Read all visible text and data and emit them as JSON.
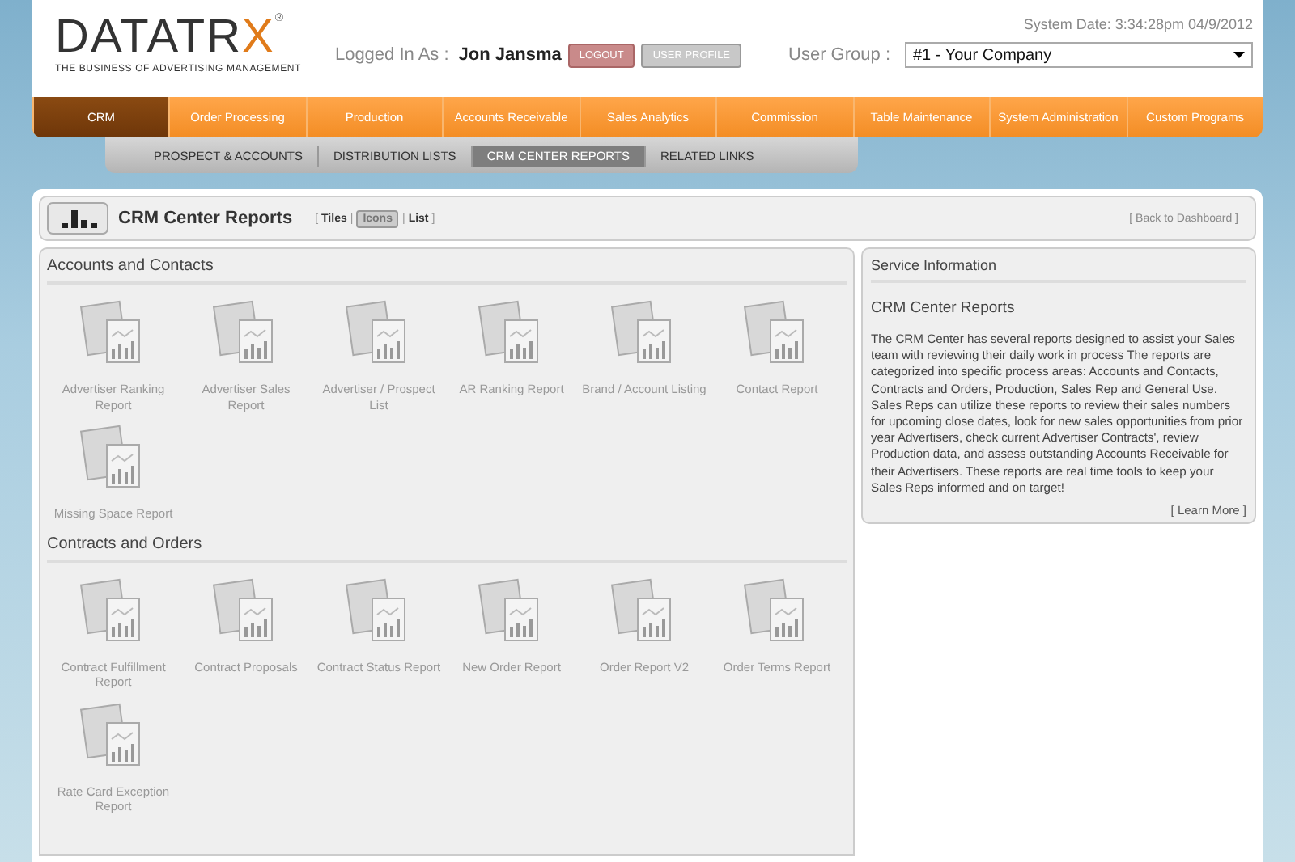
{
  "header": {
    "logo": {
      "wordmark": "DATATR",
      "accent": "X",
      "registered": "®",
      "tagline": "THE BUSINESS OF ADVERTISING MANAGEMENT"
    },
    "system_date": "System Date: 3:34:28pm 04/9/2012",
    "logged_in_label": "Logged In As :",
    "user_name": "Jon Jansma",
    "logout_button": "LOGOUT",
    "profile_button": "USER PROFILE",
    "user_group_label": "User Group :",
    "user_group_value": "#1 - Your Company"
  },
  "main_nav": [
    {
      "label": "CRM",
      "selected": true
    },
    {
      "label": "Order Processing",
      "selected": false
    },
    {
      "label": "Production",
      "selected": false
    },
    {
      "label": "Accounts Receivable",
      "selected": false
    },
    {
      "label": "Sales Analytics",
      "selected": false
    },
    {
      "label": "Commission",
      "selected": false
    },
    {
      "label": "Table Maintenance",
      "selected": false
    },
    {
      "label": "System Administration",
      "selected": false
    },
    {
      "label": "Custom Programs",
      "selected": false
    }
  ],
  "sub_nav": [
    {
      "label": "PROSPECT & ACCOUNTS",
      "selected": false
    },
    {
      "label": "DISTRIBUTION LISTS",
      "selected": false
    },
    {
      "label": "CRM CENTER REPORTS",
      "selected": true
    },
    {
      "label": "RELATED LINKS",
      "selected": false
    }
  ],
  "page_title": "CRM Center Reports",
  "view_switch": {
    "close": "]",
    "options": [
      {
        "prefix": "[",
        "label": "Tiles",
        "selected": false
      },
      {
        "prefix": "|",
        "label": "Icons",
        "selected": true
      },
      {
        "prefix": "|",
        "label": "List",
        "selected": false
      }
    ]
  },
  "back_link": "[ Back to Dashboard ]",
  "sections": [
    {
      "title": "Accounts and Contacts",
      "reports": [
        {
          "label": "Advertiser Ranking Report"
        },
        {
          "label": "Advertiser Sales Report"
        },
        {
          "label": "Advertiser / Prospect List"
        },
        {
          "label": "AR Ranking Report"
        },
        {
          "label": "Brand / Account Listing"
        },
        {
          "label": "Contact Report"
        },
        {
          "label": "Missing Space Report"
        }
      ]
    },
    {
      "title": "Contracts and Orders",
      "reports": [
        {
          "label": "Contract Fulfillment Report"
        },
        {
          "label": "Contract Proposals"
        },
        {
          "label": "Contract Status Report"
        },
        {
          "label": "New Order Report"
        },
        {
          "label": "Order Report V2"
        },
        {
          "label": "Order Terms Report"
        },
        {
          "label": "Rate Card Exception Report"
        }
      ]
    }
  ],
  "service_info": {
    "title": "Service Information",
    "heading": "CRM Center Reports",
    "body": "The CRM Center has several reports designed to assist your Sales team with reviewing their daily work in process The reports are categorized into specific process areas: Accounts and Contacts, Contracts and Orders, Production, Sales Rep and General Use. Sales Reps can utilize these reports to review their sales numbers for upcoming close dates, look for new sales opportunities from prior year Advertisers, check current Advertiser Contracts', review Production data, and assess outstanding Accounts Receivable for their Advertisers. These reports are real time tools to keep your Sales Reps informed and on target!",
    "learn_more": "[ Learn More ]"
  }
}
